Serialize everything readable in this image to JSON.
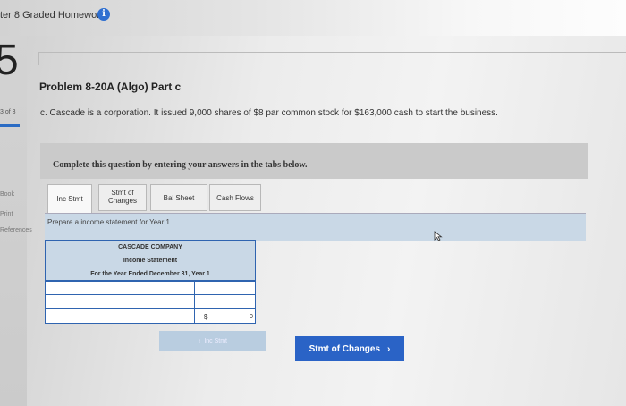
{
  "header": {
    "breadcrumb": "ter 8 Graded Homework",
    "info_icon": "i"
  },
  "question_number": "5",
  "left_nav": {
    "counter": "3 of 3",
    "links": [
      "Book",
      "Print",
      "References"
    ]
  },
  "problem": {
    "title": "Problem 8-20A (Algo) Part c",
    "description": "c. Cascade is a corporation. It issued 9,000 shares of $8 par common stock for $163,000 cash to start the business."
  },
  "instruction": "Complete this question by entering your answers in the tabs below.",
  "tabs": [
    {
      "label": "Inc Stmt",
      "active": true
    },
    {
      "label": "Stmt of Changes",
      "active": false
    },
    {
      "label": "Bal Sheet",
      "active": false
    },
    {
      "label": "Cash Flows",
      "active": false
    }
  ],
  "prompt": "Prepare a income statement for Year 1.",
  "statement": {
    "company": "CASCADE COMPANY",
    "name": "Income Statement",
    "period": "For the Year Ended December 31, Year 1",
    "rows": [
      {
        "label": "",
        "value": ""
      },
      {
        "label": "",
        "value": ""
      },
      {
        "label": "",
        "currency": "$",
        "value": "0"
      }
    ]
  },
  "nav_buttons": {
    "prev_label": "Inc Stmt",
    "next_label": "Stmt of Changes"
  },
  "colors": {
    "accent": "#2a63c6",
    "panel": "#c9d8e6"
  }
}
